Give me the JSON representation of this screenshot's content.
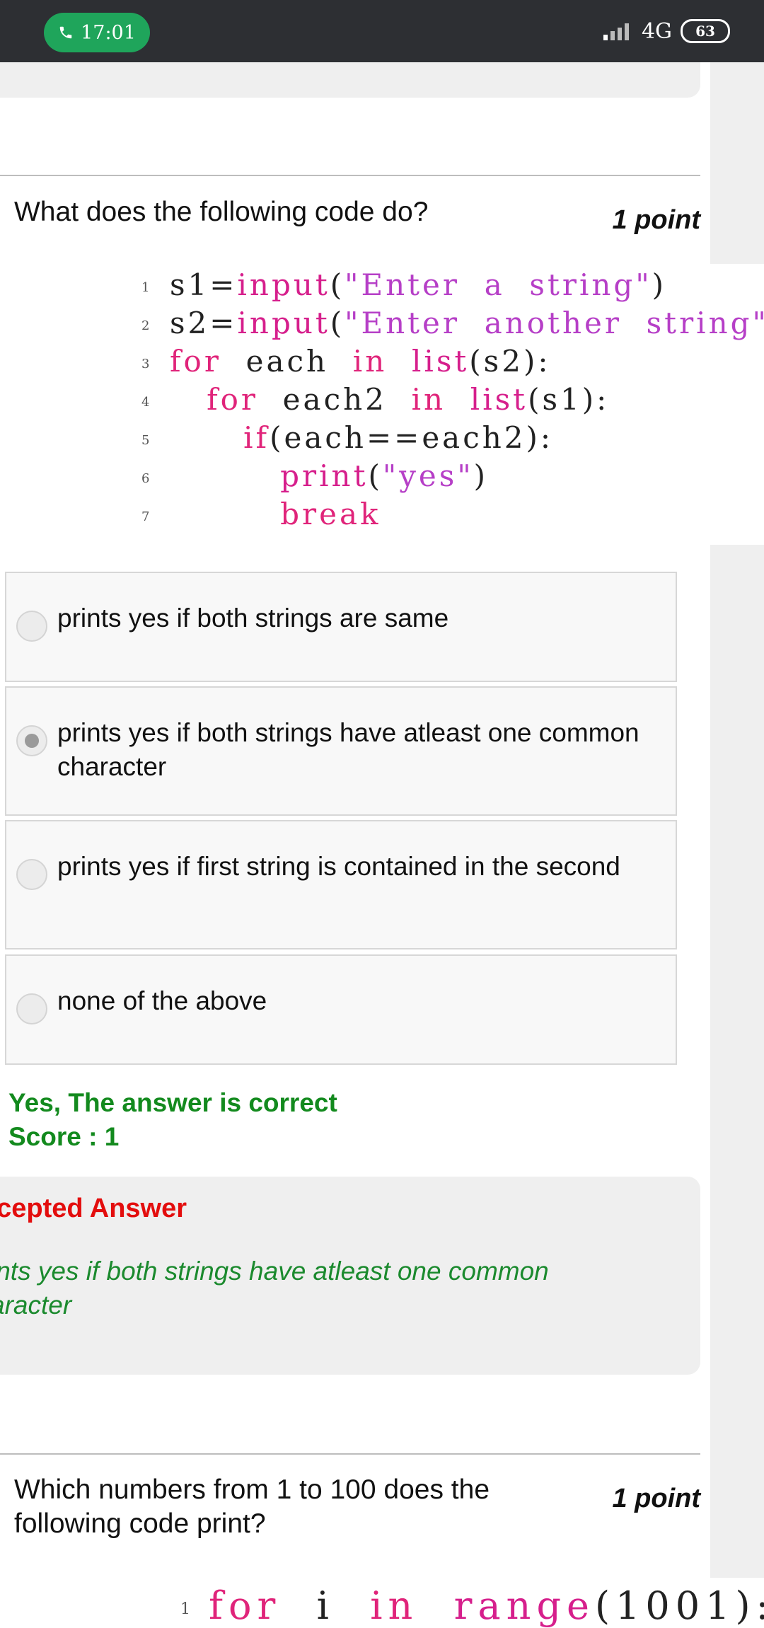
{
  "status": {
    "time": "17:01",
    "network": "4G",
    "battery": "63"
  },
  "question1": {
    "text": "What does the following code do?",
    "points": "1 point",
    "code": [
      {
        "n": "1",
        "parts": [
          [
            "s1=",
            "plain"
          ],
          [
            "input",
            "fn"
          ],
          [
            "(",
            "plain"
          ],
          [
            "\"Enter  a  string\"",
            "str"
          ],
          [
            ")",
            "plain"
          ]
        ]
      },
      {
        "n": "2",
        "parts": [
          [
            "s2=",
            "plain"
          ],
          [
            "input",
            "fn"
          ],
          [
            "(",
            "plain"
          ],
          [
            "\"Enter  another  string\"",
            "str"
          ]
        ]
      },
      {
        "n": "3",
        "parts": [
          [
            "for",
            "kw"
          ],
          [
            "  each  ",
            "plain"
          ],
          [
            "in",
            "kw"
          ],
          [
            "  ",
            "plain"
          ],
          [
            "list",
            "fn"
          ],
          [
            "(s2):",
            "plain"
          ]
        ]
      },
      {
        "n": "4",
        "parts": [
          [
            "   ",
            "plain"
          ],
          [
            "for",
            "kw"
          ],
          [
            "  each2  ",
            "plain"
          ],
          [
            "in",
            "kw"
          ],
          [
            "  ",
            "plain"
          ],
          [
            "list",
            "fn"
          ],
          [
            "(s1):",
            "plain"
          ]
        ]
      },
      {
        "n": "5",
        "parts": [
          [
            "      ",
            "plain"
          ],
          [
            "if",
            "kw"
          ],
          [
            "(each==each2):",
            "plain"
          ]
        ]
      },
      {
        "n": "6",
        "parts": [
          [
            "         ",
            "plain"
          ],
          [
            "print",
            "fn"
          ],
          [
            "(",
            "plain"
          ],
          [
            "\"yes\"",
            "str"
          ],
          [
            ")",
            "plain"
          ]
        ]
      },
      {
        "n": "7",
        "parts": [
          [
            "         ",
            "plain"
          ],
          [
            "break",
            "kw"
          ]
        ]
      }
    ],
    "options": [
      {
        "label": "prints yes if both strings are same",
        "selected": false
      },
      {
        "label": "prints yes if both strings have atleast one common character",
        "selected": true
      },
      {
        "label": "prints yes if first string is contained in the second",
        "selected": false
      },
      {
        "label": "none of the above",
        "selected": false
      }
    ],
    "feedback_correct": "Yes, The answer is correct",
    "feedback_score": "Score : 1",
    "accepted_title": "ccepted Answer",
    "accepted_answer": "ints yes if both strings have atleast one common aracter"
  },
  "question2": {
    "text": "Which numbers from 1 to 100 does the following code print?",
    "points": "1 point",
    "code_line_number": "1",
    "code_line": [
      [
        "for",
        "kw"
      ],
      [
        "  i  ",
        "plain"
      ],
      [
        "in",
        "kw"
      ],
      [
        "  ",
        "plain"
      ],
      [
        "range",
        "fn"
      ],
      [
        "(1001):",
        "plain"
      ]
    ]
  },
  "colors": {
    "keyword": "#e0247a",
    "string": "#b63fc7",
    "correct": "#138a1e",
    "accepted_title": "#e30d0d",
    "status_pill": "#1fa55b"
  }
}
